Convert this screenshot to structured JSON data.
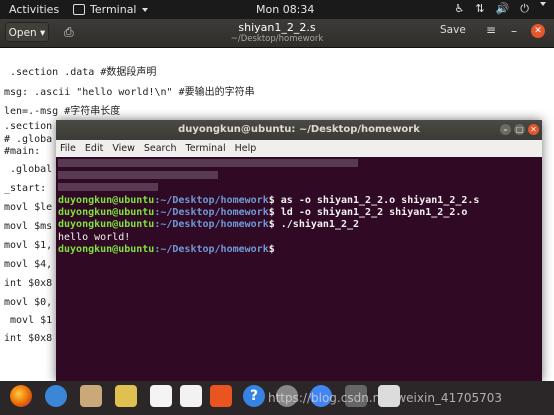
{
  "topbar": {
    "activities": "Activities",
    "app": "Terminal",
    "clock": "Mon 08:34"
  },
  "gedit": {
    "open_label": "Open",
    "title": "shiyan1_2_2.s",
    "path": "~/Desktop/homework",
    "save_label": "Save",
    "lines": [
      " .section .data #数据段声明",
      "msg: .ascii \"hello world!\\n\" #要输出的字符串",
      "len=.-msg #字符串长度",
      ".section",
      "# .globa",
      "#main:",
      " .global",
      "_start: ",
      "movl $le",
      "movl $ms",
      "movl $1,",
      "movl $4,",
      "int $0x8",
      "movl $0,",
      " movl $1",
      "int $0x8"
    ]
  },
  "terminal": {
    "title": "duyongkun@ubuntu: ~/Desktop/homework",
    "menu": [
      "File",
      "Edit",
      "View",
      "Search",
      "Terminal",
      "Help"
    ],
    "user": "duyongkun@ubuntu",
    "path": ":~/Desktop/homework",
    "cmd1": "$ as -o shiyan1_2_2.o shiyan1_2_2.s",
    "cmd2": "$ ld -o shiyan1_2_2 shiyan1_2_2.o",
    "cmd3": "$ ./shiyan1_2_2",
    "output": "hello world!",
    "cmd4": "$"
  },
  "watermark": "https://blog.csdn.net/weixin_41705703"
}
